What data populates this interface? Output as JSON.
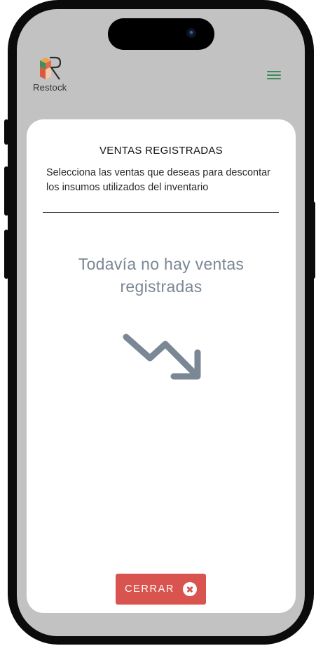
{
  "app": {
    "name": "Restock",
    "icons": {
      "logo": "restock-logo-icon",
      "menu": "hamburger-menu-icon"
    },
    "colors": {
      "menu": "#3e8a5a",
      "screen_background": "#c2c2c2"
    }
  },
  "modal": {
    "title": "VENTAS REGISTRADAS",
    "subtitle": "Selecciona las ventas que deseas para descontar los insumos utilizados del inventario",
    "empty_state": {
      "message": "Todavía no hay ventas registradas",
      "icon": "trending-down-icon",
      "color": "#7b8794"
    },
    "close_button": {
      "label": "CERRAR",
      "icon": "close-circle-icon",
      "color": "#d9534f"
    }
  }
}
